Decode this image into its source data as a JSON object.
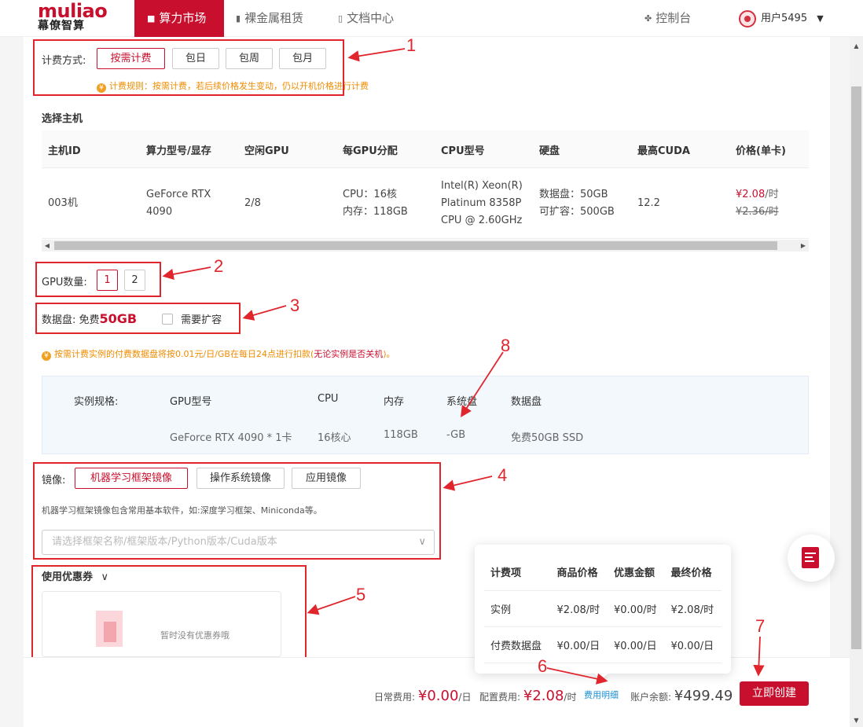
{
  "nav": {
    "logo_top": "muliao",
    "logo_bottom": "幕僚智算",
    "tabs": [
      "算力市场",
      "裸金属租赁",
      "文档中心"
    ],
    "console": "控制台",
    "user": "用户5495"
  },
  "billing": {
    "label": "计费方式:",
    "options": [
      "按需计费",
      "包日",
      "包周",
      "包月"
    ],
    "rule": "计费规则：按需计费，若后续价格发生变动，仍以开机价格进行计费"
  },
  "host_section": {
    "title": "选择主机",
    "headers": [
      "主机ID",
      "算力型号/显存",
      "空闲GPU",
      "每GPU分配",
      "CPU型号",
      "硬盘",
      "最高CUDA",
      "价格(单卡)"
    ],
    "row": {
      "id": "003机",
      "model_1": "GeForce RTX",
      "model_2": "4090",
      "free_gpu": "2/8",
      "alloc_cpu": "CPU：16核",
      "alloc_mem": "内存：118GB",
      "cpu_1": "Intel(R) Xeon(R)",
      "cpu_2": "Platinum 8358P",
      "cpu_3": "CPU @ 2.60GHz",
      "disk_1": "数据盘：50GB",
      "disk_2": "可扩容：500GB",
      "cuda": "12.2",
      "price_now_value": "¥2.08",
      "price_now_unit": "/时",
      "price_old": "¥2.36/时"
    }
  },
  "gpu_count": {
    "label": "GPU数量:",
    "options": [
      "1",
      "2"
    ]
  },
  "data_disk": {
    "label": "数据盘: 免费",
    "size": "50GB",
    "expand": "需要扩容"
  },
  "disk_notice_a": "按需计费实例的付费数据盘将按0.01元/日/GB在每日24点进行扣款(",
  "disk_notice_b": "无论实例是否关机",
  "disk_notice_c": ")。",
  "spec": {
    "label": "实例规格:",
    "headers": [
      "GPU型号",
      "CPU",
      "内存",
      "系统盘",
      "数据盘"
    ],
    "values": [
      "GeForce RTX 4090 * 1卡",
      "16核心",
      "118GB",
      "-GB",
      "免费50GB SSD"
    ]
  },
  "image": {
    "label": "镜像:",
    "options": [
      "机器学习框架镜像",
      "操作系统镜像",
      "应用镜像"
    ],
    "desc": "机器学习框架镜像包含常用基本软件，如:深度学习框架、Miniconda等。",
    "placeholder": "请选择框架名称/框架版本/Python版本/Cuda版本"
  },
  "coupon": {
    "label": "使用优惠券",
    "empty": "暂时没有优惠券哦"
  },
  "popup": {
    "headers": [
      "计费项",
      "商品价格",
      "优惠金额",
      "最终价格"
    ],
    "rows": [
      [
        "实例",
        "¥2.08/时",
        "¥0.00/时",
        "¥2.08/时"
      ],
      [
        "付费数据盘",
        "¥0.00/日",
        "¥0.00/日",
        "¥0.00/日"
      ]
    ]
  },
  "footer": {
    "daily_label": "日常费用:",
    "daily_value": "¥0.00",
    "daily_unit": "/日",
    "config_label": "配置费用:",
    "config_value": "¥2.08",
    "config_unit": "/时",
    "detail_link": "费用明细",
    "balance_label": "账户余额:",
    "balance_value": "¥499.49",
    "create": "立即创建"
  },
  "annotations": [
    "1",
    "2",
    "3",
    "4",
    "5",
    "6",
    "7",
    "8"
  ],
  "colors": {
    "brand": "#c8102e",
    "annotation": "#e0252d",
    "warning": "#f08c00",
    "link": "#1a8fd6"
  }
}
